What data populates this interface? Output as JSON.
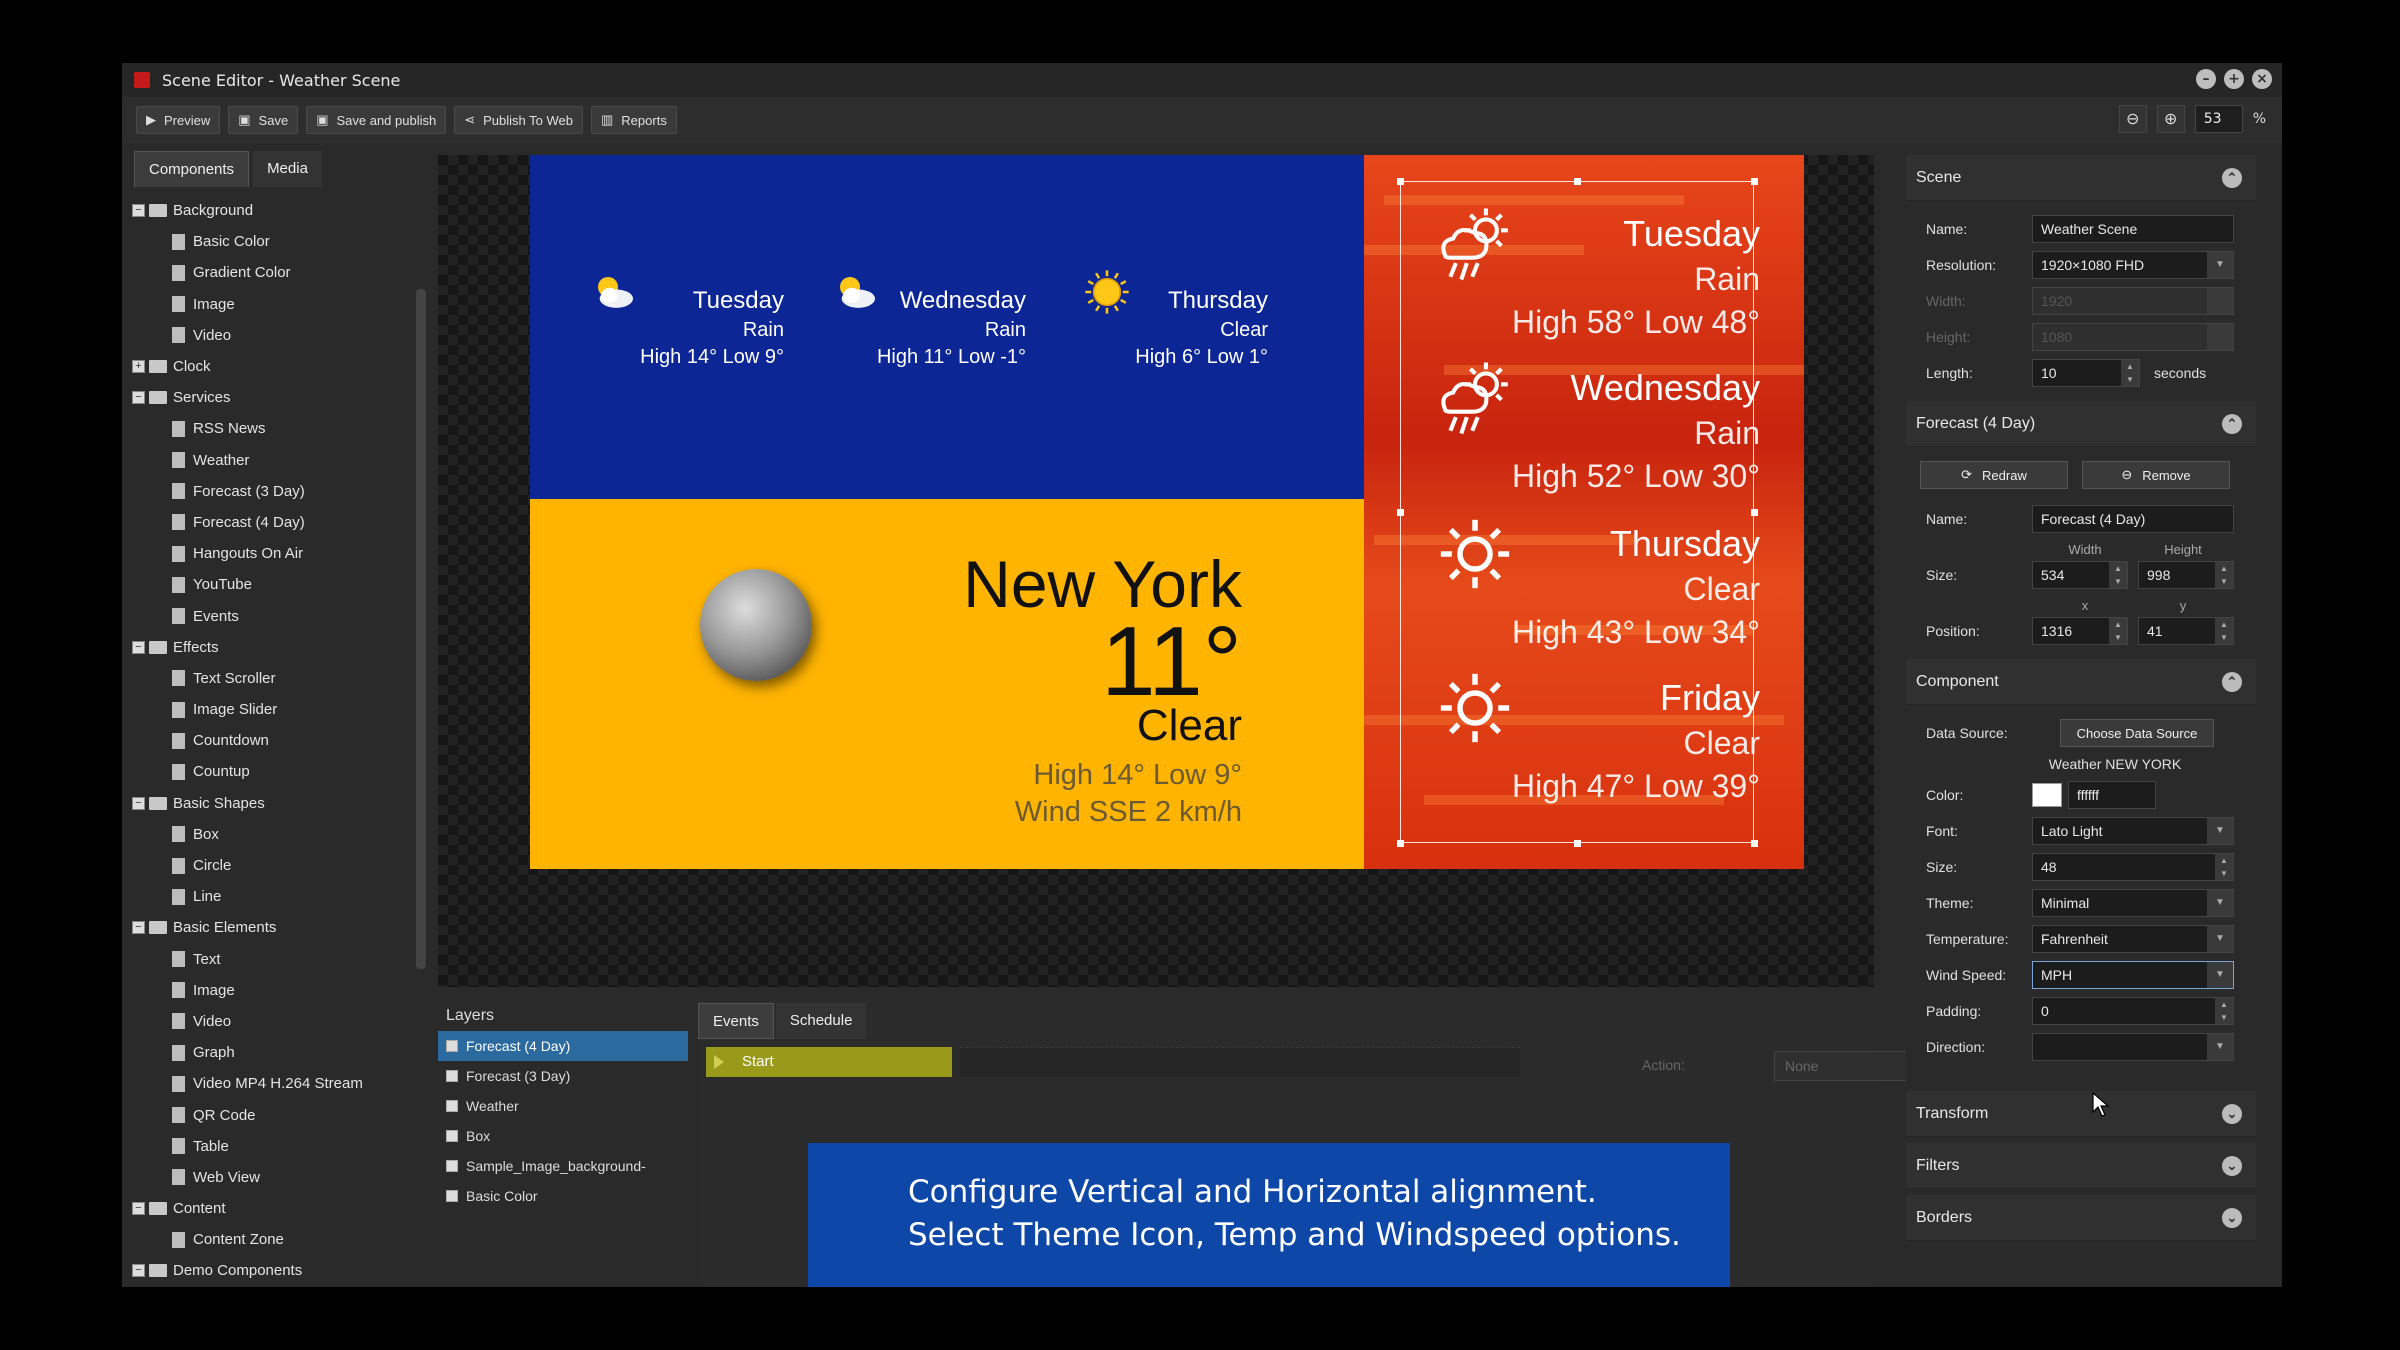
{
  "window": {
    "title": "Scene Editor - Weather Scene",
    "controls": [
      "minimize",
      "maximize",
      "close"
    ]
  },
  "toolbar": {
    "buttons": [
      {
        "label": "Preview",
        "icon": "play-icon"
      },
      {
        "label": "Save",
        "icon": "floppy-icon"
      },
      {
        "label": "Save and publish",
        "icon": "floppy-icon"
      },
      {
        "label": "Publish To Web",
        "icon": "share-icon"
      },
      {
        "label": "Reports",
        "icon": "chart-icon"
      }
    ],
    "zoom_value": "53",
    "zoom_unit": "%"
  },
  "left": {
    "tabs": [
      "Components",
      "Media"
    ],
    "active_tab": "Components",
    "tree": [
      {
        "label": "Background",
        "children": [
          "Basic Color",
          "Gradient Color",
          "Image",
          "Video"
        ]
      },
      {
        "label": "Clock",
        "collapsed": true,
        "children": []
      },
      {
        "label": "Services",
        "children": [
          "RSS News",
          "Weather",
          "Forecast (3 Day)",
          "Forecast (4 Day)",
          "Hangouts On Air",
          "YouTube",
          "Events"
        ]
      },
      {
        "label": "Effects",
        "children": [
          "Text Scroller",
          "Image Slider",
          "Countdown",
          "Countup"
        ]
      },
      {
        "label": "Basic Shapes",
        "children": [
          "Box",
          "Circle",
          "Line"
        ]
      },
      {
        "label": "Basic Elements",
        "children": [
          "Text",
          "Image",
          "Video",
          "Graph",
          "Video MP4 H.264 Stream",
          "QR Code",
          "Table",
          "Web View"
        ]
      },
      {
        "label": "Content",
        "children": [
          "Content Zone"
        ]
      },
      {
        "label": "Demo Components",
        "children": []
      }
    ]
  },
  "scene": {
    "small_forecast": [
      {
        "day": "Tuesday",
        "cond": "Rain",
        "hl": "High 14° Low 9°",
        "icon": "cloud-sun-icon"
      },
      {
        "day": "Wednesday",
        "cond": "Rain",
        "hl": "High 11° Low -1°",
        "icon": "cloud-sun-icon"
      },
      {
        "day": "Thursday",
        "cond": "Clear",
        "hl": "High 6° Low 1°",
        "icon": "sun-icon"
      }
    ],
    "current": {
      "city": "New York",
      "temp": "11°",
      "cond": "Clear",
      "hl": "High 14° Low 9°",
      "wind": "Wind SSE 2 km/h",
      "icon": "moon-icon"
    },
    "big_forecast": [
      {
        "day": "Tuesday",
        "cond": "Rain",
        "hl": "High 58° Low 48°",
        "icon": "rain-icon"
      },
      {
        "day": "Wednesday",
        "cond": "Rain",
        "hl": "High 52° Low 30°",
        "icon": "rain-icon"
      },
      {
        "day": "Thursday",
        "cond": "Clear",
        "hl": "High 43° Low 34°",
        "icon": "sun-outline-icon"
      },
      {
        "day": "Friday",
        "cond": "Clear",
        "hl": "High 47° Low 39°",
        "icon": "sun-outline-icon"
      }
    ],
    "colors": {
      "blue": "#0c2696",
      "yellow": "#ffb400",
      "red": "#e8461a"
    }
  },
  "layers": {
    "title": "Layers",
    "items": [
      "Forecast (4 Day)",
      "Forecast (3 Day)",
      "Weather",
      "Box",
      "Sample_Image_background-",
      "Basic Color"
    ],
    "selected": "Forecast (4 Day)"
  },
  "events": {
    "tabs": [
      "Events",
      "Schedule"
    ],
    "start_label": "Start",
    "action_label": "Action:",
    "action_value": "None"
  },
  "caption": {
    "line1": "Configure Vertical and Horizontal alignment.",
    "line2": "Select Theme Icon, Temp and Windspeed options."
  },
  "props": {
    "scene": {
      "title": "Scene",
      "name_label": "Name:",
      "name": "Weather Scene",
      "res_label": "Resolution:",
      "resolution": "1920×1080 FHD",
      "width_label": "Width:",
      "width": "1920",
      "height_label": "Height:",
      "height": "1080",
      "length_label": "Length:",
      "length": "10",
      "length_unit": "seconds"
    },
    "forecast": {
      "title": "Forecast (4 Day)",
      "redraw": "Redraw",
      "remove": "Remove",
      "name_label": "Name:",
      "name": "Forecast (4 Day)",
      "width_cap": "Width",
      "height_cap": "Height",
      "size_label": "Size:",
      "size_w": "534",
      "size_h": "998",
      "x_cap": "x",
      "y_cap": "y",
      "pos_label": "Position:",
      "pos_x": "1316",
      "pos_y": "41"
    },
    "component": {
      "title": "Component",
      "ds_label": "Data Source:",
      "ds_button": "Choose Data Source",
      "ds_value": "Weather NEW YORK",
      "color_label": "Color:",
      "color": "ffffff",
      "font_label": "Font:",
      "font": "Lato Light",
      "size_label": "Size:",
      "size": "48",
      "theme_label": "Theme:",
      "theme": "Minimal",
      "temp_label": "Temperature:",
      "temp": "Fahrenheit",
      "wind_label": "Wind Speed:",
      "wind": "MPH",
      "pad_label": "Padding:",
      "padding": "0",
      "dir_label": "Direction:",
      "direction": ""
    },
    "collapsed": [
      "Transform",
      "Filters",
      "Borders"
    ]
  }
}
